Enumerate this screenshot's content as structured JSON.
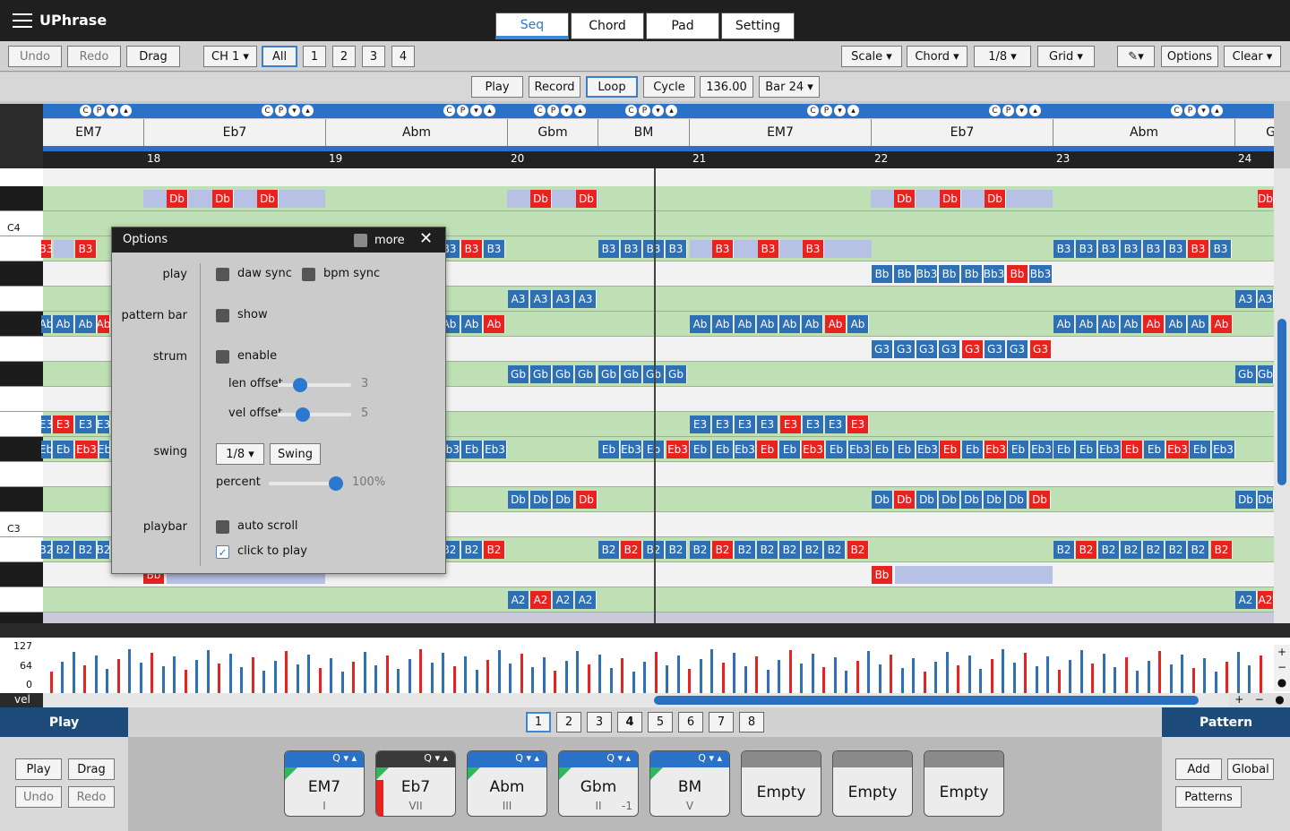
{
  "app": {
    "title": "UPhrase"
  },
  "tabs": [
    {
      "label": "Seq"
    },
    {
      "label": "Chord"
    },
    {
      "label": "Pad"
    },
    {
      "label": "Setting"
    }
  ],
  "toolbar": {
    "undo": "Undo",
    "redo": "Redo",
    "drag": "Drag",
    "channel": "CH 1 ▾",
    "all": "All",
    "ch1": "1",
    "ch2": "2",
    "ch3": "3",
    "ch4": "4",
    "scale": "Scale ▾",
    "chord": "Chord ▾",
    "division": "1/8 ▾",
    "grid": "Grid ▾",
    "pencil": "▾",
    "options": "Options",
    "clear": "Clear ▾"
  },
  "transport": {
    "play": "Play",
    "record": "Record",
    "loop": "Loop",
    "cycle": "Cycle",
    "bpm": "136.00",
    "bar": "Bar 24 ▾"
  },
  "chords": [
    {
      "name": "EM7"
    },
    {
      "name": "Eb7"
    },
    {
      "name": "Abm"
    },
    {
      "name": "Gbm"
    },
    {
      "name": "BM"
    },
    {
      "name": "EM7"
    },
    {
      "name": "Eb7"
    },
    {
      "name": "Abm"
    },
    {
      "name": "G"
    }
  ],
  "bars": [
    "18",
    "19",
    "20",
    "21",
    "22",
    "23",
    "24"
  ],
  "keys": {
    "c4": "C4",
    "c3": "C3"
  },
  "velocity": {
    "max": "127",
    "mid": "64",
    "min": "0",
    "label": "vel"
  },
  "options_dialog": {
    "title": "Options",
    "more": "more",
    "play": "play",
    "daw_sync": "daw sync",
    "bpm_sync": "bpm sync",
    "pattern_bar": "pattern bar",
    "show": "show",
    "strum": "strum",
    "enable": "enable",
    "len_offset": "len offset",
    "len_value": "3",
    "len_fraction": 0.3,
    "vel_offset": "vel offset",
    "vel_value": "5",
    "vel_fraction": 0.34,
    "swing": "swing",
    "swing_div": "1/8 ▾",
    "swing_btn": "Swing",
    "percent": "percent",
    "percent_value": "100%",
    "percent_fraction": 1.0,
    "playbar": "playbar",
    "auto_scroll": "auto scroll",
    "click_to_play": "click to play"
  },
  "bottom": {
    "play_title": "Play",
    "pattern_title": "Pattern",
    "play": "Play",
    "drag": "Drag",
    "undo": "Undo",
    "redo": "Redo",
    "add": "Add",
    "global": "Global",
    "patterns": "Patterns",
    "pages": [
      "1",
      "2",
      "3",
      "4",
      "5",
      "6",
      "7",
      "8"
    ],
    "cards": [
      {
        "name": "EM7",
        "roman": "I",
        "offset": ""
      },
      {
        "name": "Eb7",
        "roman": "VII",
        "offset": ""
      },
      {
        "name": "Abm",
        "roman": "III",
        "offset": ""
      },
      {
        "name": "Gbm",
        "roman": "II",
        "offset": "-1"
      },
      {
        "name": "BM",
        "roman": "V",
        "offset": ""
      },
      {
        "name": "Empty",
        "roman": "",
        "offset": ""
      },
      {
        "name": "Empty",
        "roman": "",
        "offset": ""
      },
      {
        "name": "Empty",
        "roman": "",
        "offset": ""
      }
    ],
    "card_icons": "Q ▾ ▴"
  },
  "notes": {
    "Db": "Db",
    "B3": "B3",
    "Bb": "Bb",
    "Bb3": "Bb3",
    "A3": "A3",
    "Ab": "Ab",
    "G3": "G3",
    "Gb": "Gb",
    "E3": "E3",
    "Eb": "Eb",
    "Eb3": "Eb3",
    "B2": "B2",
    "A2": "A2"
  },
  "colors": {
    "accent": "#2b78d0",
    "note_blue": "#2f6fb3",
    "note_red": "#e7221f",
    "row_green": "#bfe0b5"
  }
}
